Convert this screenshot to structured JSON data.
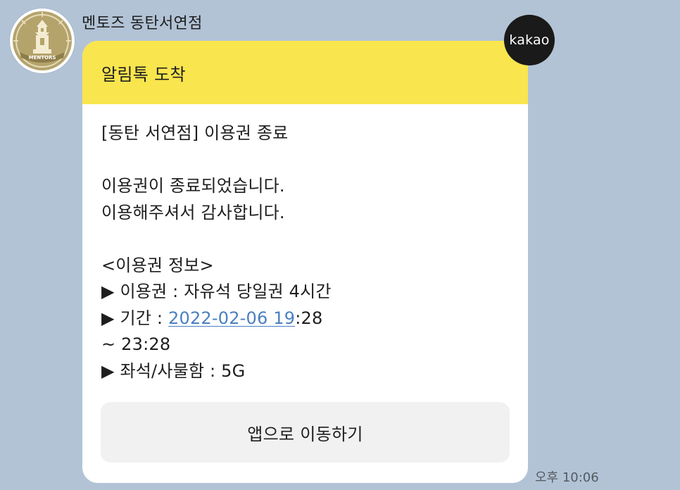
{
  "sender": {
    "name": "멘토즈 동탄서연점",
    "avatar_text": "MENTORS"
  },
  "badge": {
    "label": "kakao"
  },
  "message": {
    "header_title": "알림톡 도착",
    "subject": "[동탄 서연점] 이용권 종료",
    "line_end_1": "이용권이 종료되었습니다.",
    "line_end_2": "이용해주셔서 감사합니다.",
    "info_heading": "<이용권 정보>",
    "ticket_line": "▶ 이용권 : 자유석 당일권 4시간",
    "period_prefix": "▶ 기간 : ",
    "period_link": "2022-02-06 19",
    "period_suffix": ":28",
    "period_end": "~ 23:28",
    "seat_line": "▶ 좌석/사물함 : 5G",
    "button_label": "앱으로 이동하기"
  },
  "timestamp": "오후 10:06",
  "colors": {
    "background": "#b2c3d6",
    "header_yellow": "#f9e54e",
    "link_blue": "#4a7fc1",
    "badge_dark": "#1a1a1a"
  }
}
